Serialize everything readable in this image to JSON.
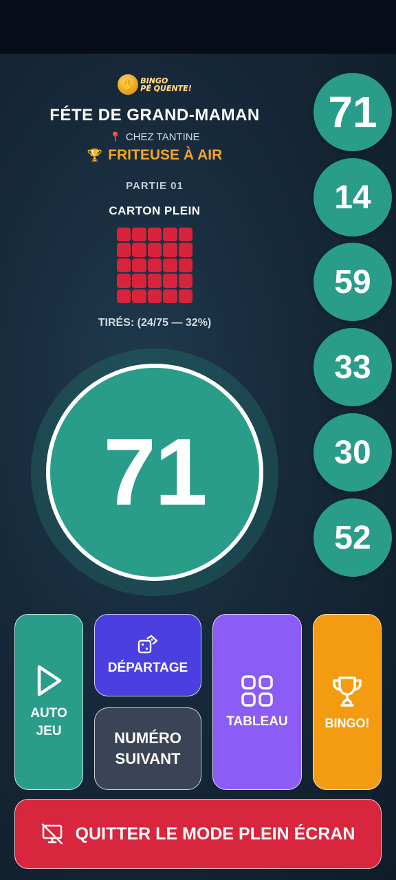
{
  "header": {
    "logo_line1": "BINGO",
    "logo_line2": "PÉ QUENTE!",
    "event_title": "FÉTE DE GRAND-MAMAN",
    "location": "CHEZ TANTINE",
    "prize": "FRITEUSE À AIR"
  },
  "game": {
    "number_label": "PARTIE 01",
    "pattern_name": "CARTON PLEIN",
    "drawn_status": "TIRÉS: (24/75 — 32%)",
    "drawn_count": 24,
    "total_numbers": 75,
    "progress_percent": 32
  },
  "current_ball": "71",
  "history": [
    "71",
    "14",
    "59",
    "33",
    "30",
    "52"
  ],
  "buttons": {
    "auto_line1": "AUTO",
    "auto_line2": "JEU",
    "tiebreak": "DÉPARTAGE",
    "next_line1": "NUMÉRO",
    "next_line2": "SUIVANT",
    "board": "TABLEAU",
    "bingo": "BINGO!",
    "exit_fullscreen": "QUITTER LE MODE PLEIN ÉCRAN"
  },
  "colors": {
    "ball": "#2a9d8a",
    "pattern_cell": "#d9233a",
    "prize": "#f5a623",
    "tiebreak": "#4b3fe0",
    "next": "#3a4456",
    "board": "#8b5cf6",
    "bingo": "#f39c12",
    "exit": "#d7263d"
  },
  "icons": {
    "play": "play-icon",
    "dice": "dice-icon",
    "grid": "grid-icon",
    "trophy": "trophy-icon",
    "exit": "monitor-off-icon",
    "pin": "pin-icon"
  }
}
